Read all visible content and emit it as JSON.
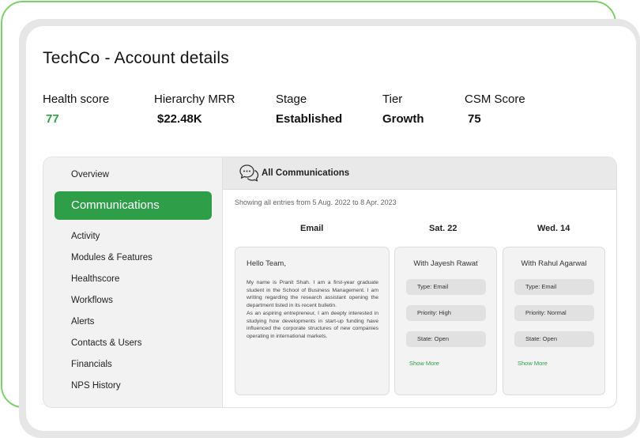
{
  "page": {
    "title": "TechCo - Account details"
  },
  "metrics": [
    {
      "label": "Health score",
      "value": "77"
    },
    {
      "label": "Hierarchy MRR",
      "value": "$22.48K"
    },
    {
      "label": "Stage",
      "value": "Established"
    },
    {
      "label": "Tier",
      "value": "Growth"
    },
    {
      "label": "CSM Score",
      "value": "75"
    }
  ],
  "colors": {
    "accent_green": "#2f9e48",
    "frame_green": "#7ccf6a",
    "panel_gray": "#f2f2f2"
  },
  "sidebar": {
    "items": [
      {
        "label": "Overview"
      },
      {
        "label": "Communications",
        "active": true
      },
      {
        "label": "Activity"
      },
      {
        "label": "Modules & Features"
      },
      {
        "label": "Healthscore"
      },
      {
        "label": "Workflows"
      },
      {
        "label": "Alerts"
      },
      {
        "label": "Contacts & Users"
      },
      {
        "label": "Financials"
      },
      {
        "label": "NPS History"
      }
    ]
  },
  "communications": {
    "icon": "chat-bubbles-icon",
    "title": "All Communications",
    "range_text": "Showing all entries from 5 Aug. 2022 to 8 Apr. 2023",
    "columns": [
      "Email",
      "Sat. 22",
      "Wed. 14"
    ],
    "email": {
      "greeting": "Hello Team,",
      "paragraph1": "My name is Pranit Shah. I am a first-year graduate student in the School of Business Management. I am writing regarding the research assistant opening the department listed in its recent bulletin.",
      "paragraph2": "As an aspiring entrepreneur, I am deeply interested in studying how developments in start-up funding have influenced the corporate structures of new companies operating in international markets."
    },
    "entries": [
      {
        "with": "With Jayesh Rawat",
        "type": "Type: Email",
        "priority": "Priority: High",
        "state": "State: Open",
        "action": "Show More"
      },
      {
        "with": "With Rahul Agarwal",
        "type": "Type: Email",
        "priority": "Priority: Normal",
        "state": "State: Open",
        "action": "Show More"
      }
    ]
  }
}
